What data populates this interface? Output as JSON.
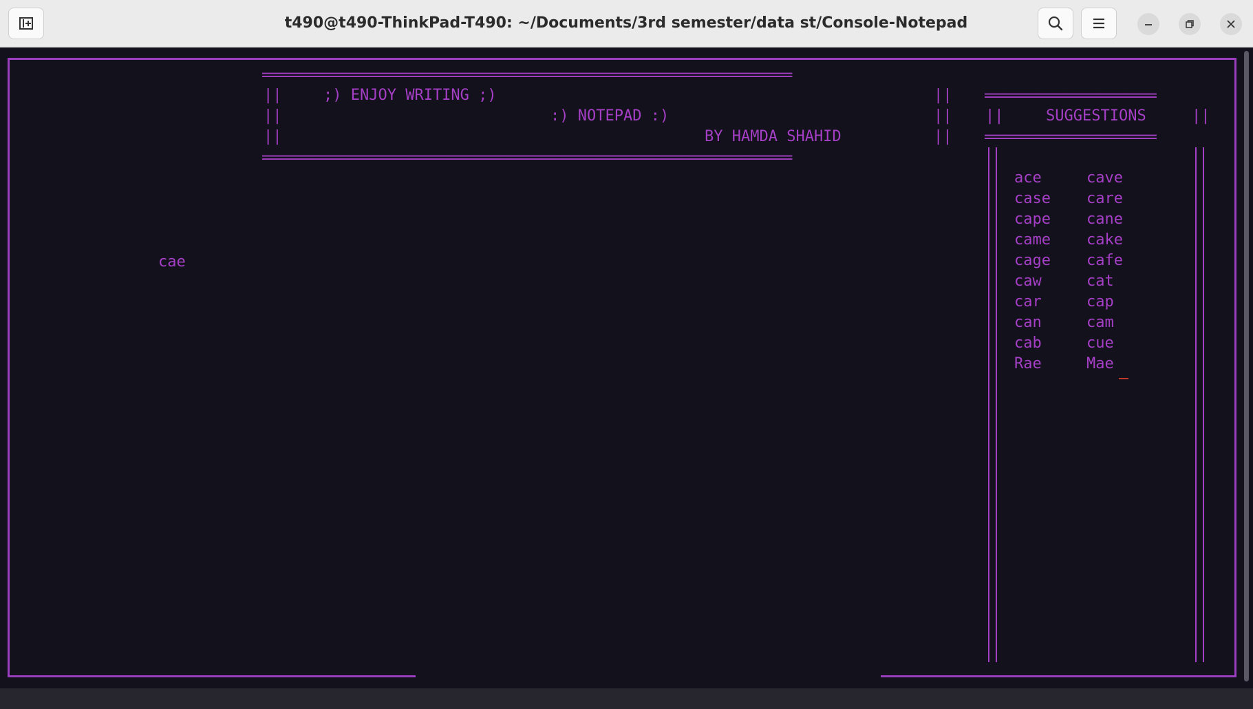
{
  "window": {
    "title": "t490@t490-ThinkPad-T490: ~/Documents/3rd semester/data st/Console-Notepad"
  },
  "icons": {
    "new_tab": "new-tab-icon",
    "search": "search-icon",
    "menu": "hamburger-menu-icon",
    "minimize": "minimize-icon",
    "restore": "restore-icon",
    "close": "close-icon"
  },
  "colors": {
    "terminal_bg": "#13111c",
    "text": "#a53fc6",
    "frame": "#9a3dc0",
    "cursor": "#c0392b"
  },
  "header": {
    "border": "=======================================================================",
    "line1_bars": "||",
    "line1": ";) ENJOY WRITING ;)",
    "line2": ":) NOTEPAD :)",
    "line3": "BY HAMDA SHAHID"
  },
  "editor": {
    "typed_text": "cae"
  },
  "suggestions": {
    "border": "=======================",
    "title": "SUGGESTIONS",
    "bars": "||",
    "items": [
      [
        "ace",
        "cave"
      ],
      [
        "case",
        "care"
      ],
      [
        "cape",
        "cane"
      ],
      [
        "came",
        "cake"
      ],
      [
        "cage",
        "cafe"
      ],
      [
        "caw",
        "cat"
      ],
      [
        "car",
        "cap"
      ],
      [
        "can",
        "cam"
      ],
      [
        "cab",
        "cue"
      ],
      [
        "Rae",
        "Mae"
      ]
    ]
  }
}
